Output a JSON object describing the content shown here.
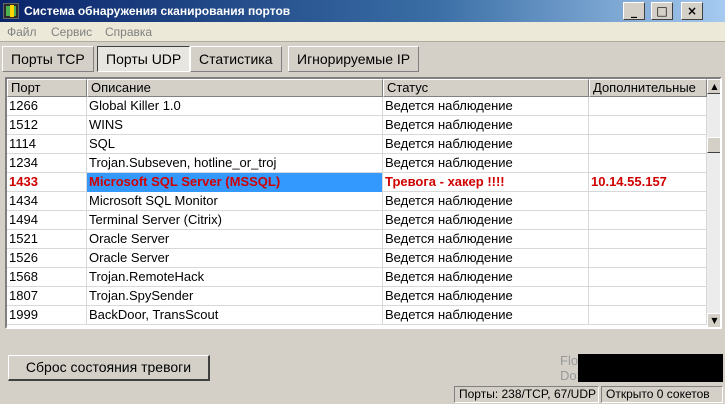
{
  "window": {
    "title": "Система обнаружения сканирования портов",
    "minimize": "_",
    "maximize": "□",
    "close": "×"
  },
  "menu": [
    "Файл",
    "Сервис",
    "Справка"
  ],
  "tabs": [
    {
      "label": "Порты TCP",
      "active": false
    },
    {
      "label": "Порты UDP",
      "active": true
    },
    {
      "label": "Статистика",
      "active": false
    },
    {
      "label": "Игнорируемые IP",
      "active": false
    }
  ],
  "table": {
    "columns": [
      "Порт",
      "Описание",
      "Статус",
      "Дополнительные"
    ],
    "rows": [
      {
        "port": "1266",
        "description": "Global Killer 1.0",
        "status": "Ведется наблюдение",
        "extra": ""
      },
      {
        "port": "1512",
        "description": "WINS",
        "status": "Ведется наблюдение",
        "extra": ""
      },
      {
        "port": "1114",
        "description": "SQL",
        "status": "Ведется наблюдение",
        "extra": ""
      },
      {
        "port": "1234",
        "description": "Trojan.Subseven, hotline_or_troj",
        "status": "Ведется наблюдение",
        "extra": ""
      },
      {
        "port": "1433",
        "description": "Microsoft SQL Server (MSSQL)",
        "status": "Тревога - хакер !!!!",
        "extra": "10.14.55.157",
        "alert": true,
        "selected": true
      },
      {
        "port": "1434",
        "description": "Microsoft SQL Monitor",
        "status": "Ведется наблюдение",
        "extra": ""
      },
      {
        "port": "1494",
        "description": "Terminal Server (Citrix)",
        "status": "Ведется наблюдение",
        "extra": ""
      },
      {
        "port": "1521",
        "description": "Oracle Server",
        "status": "Ведется наблюдение",
        "extra": ""
      },
      {
        "port": "1526",
        "description": "Oracle Server",
        "status": "Ведется наблюдение",
        "extra": ""
      },
      {
        "port": "1568",
        "description": "Trojan.RemoteHack",
        "status": "Ведется наблюдение",
        "extra": ""
      },
      {
        "port": "1807",
        "description": "Trojan.SpySender",
        "status": "Ведется наблюдение",
        "extra": ""
      },
      {
        "port": "1999",
        "description": "BackDoor, TransScout",
        "status": "Ведется наблюдение",
        "extra": ""
      }
    ]
  },
  "colors": {
    "alert_text": "#d00000",
    "selection": "#3399ff"
  },
  "reset_button": "Сброс состояния тревоги",
  "flood": {
    "label1": "Flood",
    "label2": "DoS"
  },
  "statusbar": {
    "ports": "Порты: 238/TCP, 67/UDP",
    "sockets": "Открыто 0 сокетов"
  }
}
